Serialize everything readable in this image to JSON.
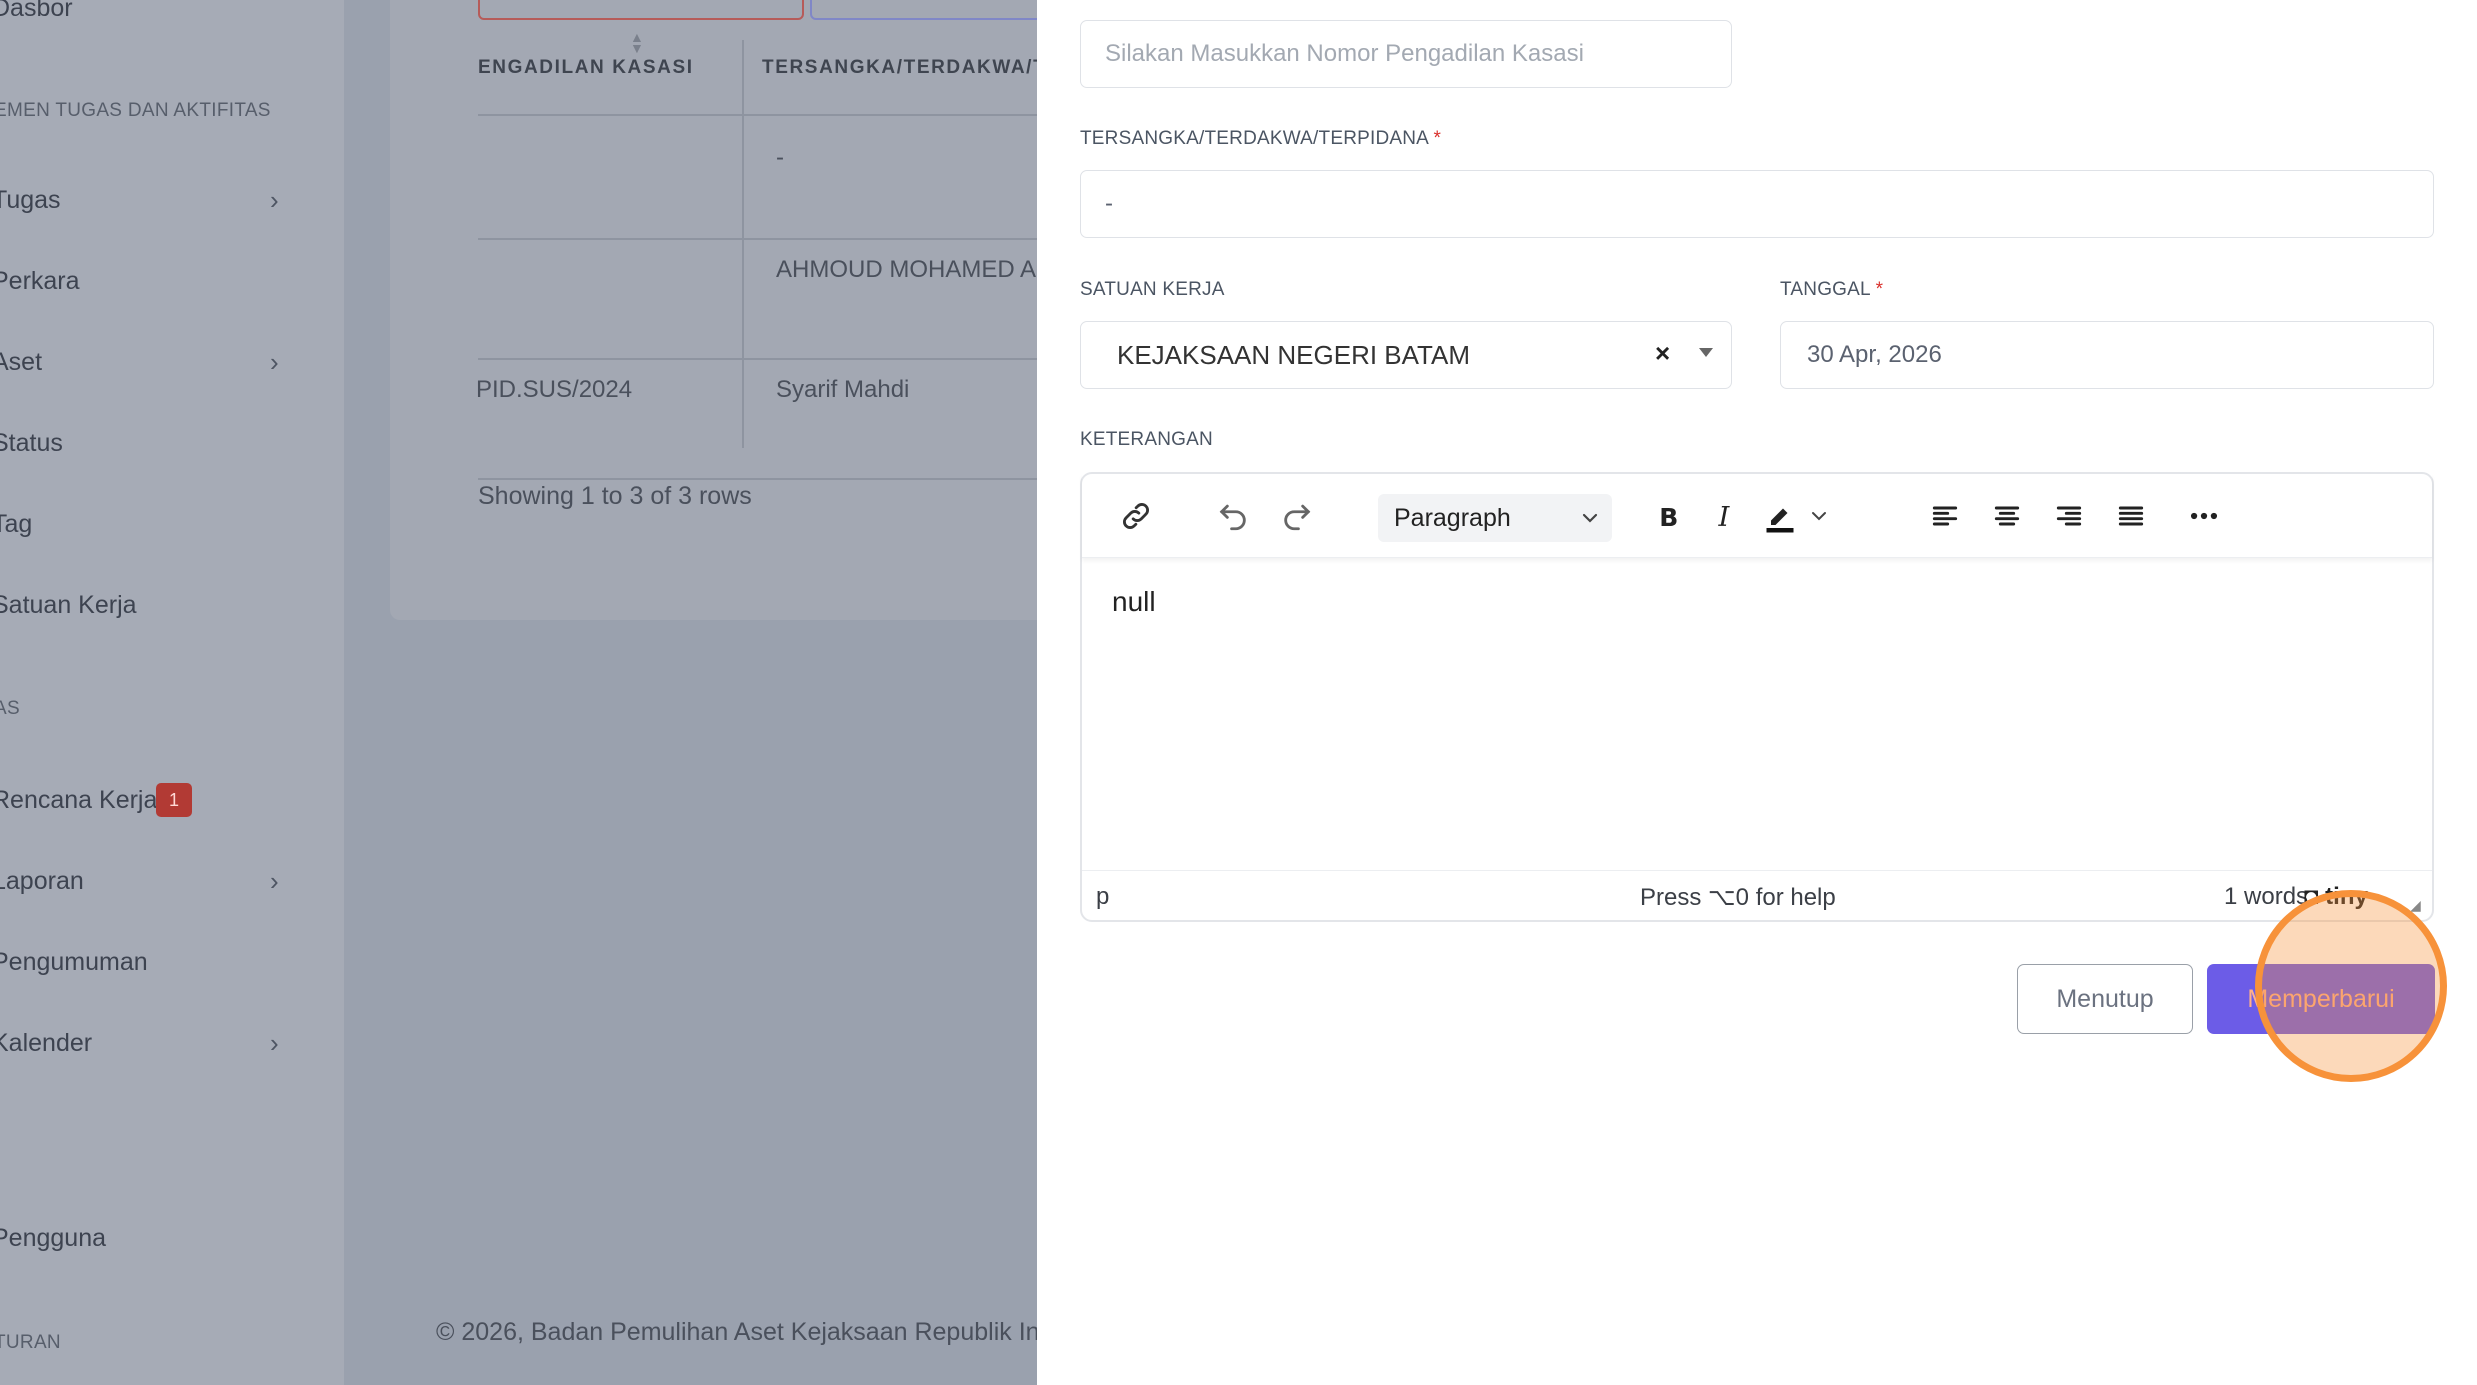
{
  "sidebar": {
    "items": [
      {
        "label": "Dasbor",
        "chevron": false
      },
      {
        "section": "EMEN TUGAS DAN AKTIFITAS"
      },
      {
        "label": "Tugas",
        "chevron": true
      },
      {
        "label": "Perkara",
        "chevron": false
      },
      {
        "label": "Aset",
        "chevron": true
      },
      {
        "label": "Status",
        "chevron": false
      },
      {
        "label": "Tag",
        "chevron": false
      },
      {
        "label": "Satuan Kerja",
        "chevron": false
      },
      {
        "section": "AS"
      },
      {
        "label": "Rencana Kerja",
        "badge": "1"
      },
      {
        "label": "Laporan",
        "chevron": true
      },
      {
        "label": "Pengumuman",
        "chevron": false
      },
      {
        "label": "Kalender",
        "chevron": true
      },
      {
        "label": "Pengguna",
        "chevron": false
      },
      {
        "section": "TURAN"
      }
    ],
    "chevron_glyph": "›"
  },
  "table": {
    "headers": [
      "ENGADILAN KASASI",
      "TERSANGKA/TERDAKWA/TERP"
    ],
    "rows": [
      [
        "",
        "-"
      ],
      [
        "",
        "AHMOUD MOHAMED ABDEL"
      ],
      [
        "PID.SUS/2024",
        "Syarif Mahdi"
      ]
    ],
    "showing": "Showing 1 to 3 of 3 rows"
  },
  "footer": {
    "text": "© 2026, Badan Pemulihan Aset Kejaksaan Republik In"
  },
  "form": {
    "nomor_placeholder": "Silakan Masukkan Nomor Pengadilan Kasasi",
    "tersangka_label": "TERSANGKA/TERDAKWA/TERPIDANA",
    "tersangka_value": "-",
    "satuan_label": "SATUAN KERJA",
    "satuan_value": "KEJAKSAAN NEGERI BATAM",
    "tanggal_label": "TANGGAL",
    "tanggal_value": "30 Apr, 2026",
    "keterangan_label": "KETERANGAN",
    "required_mark": "*",
    "clear_glyph": "×"
  },
  "editor": {
    "block_format": "Paragraph",
    "content": "null",
    "path": "p",
    "help": "Press ⌥0 for help",
    "word_count": "1 words",
    "brand": "tiny"
  },
  "buttons": {
    "close": "Menutup",
    "update": "Memperbarui"
  },
  "colors": {
    "primary": "#6c5ce7",
    "danger_badge": "#b23a34",
    "highlight": "#f7923a"
  },
  "icons": [
    "link-icon",
    "undo-icon",
    "redo-icon",
    "bold-icon",
    "italic-icon",
    "highlight-color-icon",
    "align-left-icon",
    "align-center-icon",
    "align-right-icon",
    "align-justify-icon",
    "more-icon",
    "chevron-down-icon",
    "close-icon"
  ]
}
